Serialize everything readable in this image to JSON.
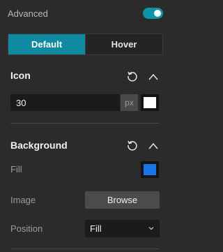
{
  "advanced": {
    "label": "Advanced",
    "enabled": true
  },
  "tabs": [
    {
      "label": "Default",
      "active": true
    },
    {
      "label": "Hover",
      "active": false
    }
  ],
  "icon_section": {
    "title": "Icon",
    "size_value": "30",
    "unit": "px",
    "color": "#ffffff"
  },
  "background_section": {
    "title": "Background",
    "fill_label": "Fill",
    "fill_color": "#1a73e8",
    "image_label": "Image",
    "browse_label": "Browse",
    "position_label": "Position",
    "position_value": "Fill"
  },
  "colors": {
    "accent": "#0f8aa0",
    "panel_bg": "#2b2b2b"
  }
}
